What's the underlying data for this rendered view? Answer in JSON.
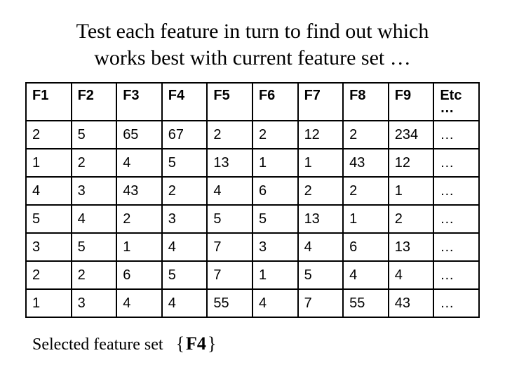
{
  "title_line1": "Test each feature in turn to find out which",
  "title_line2": "works best with current feature set …",
  "chart_data": {
    "type": "table",
    "headers": [
      "F1",
      "F2",
      "F3",
      "F4",
      "F5",
      "F6",
      "F7",
      "F8",
      "F9",
      "Etc"
    ],
    "rows": [
      [
        "2",
        "5",
        "65",
        "67",
        "2",
        "2",
        "12",
        "2",
        "234",
        "…"
      ],
      [
        "1",
        "2",
        "4",
        "5",
        "13",
        "1",
        "1",
        "43",
        "12",
        "…"
      ],
      [
        "4",
        "3",
        "43",
        "2",
        "4",
        "6",
        "2",
        "2",
        "1",
        "…"
      ],
      [
        "5",
        "4",
        "2",
        "3",
        "5",
        "5",
        "13",
        "1",
        "2",
        "…"
      ],
      [
        "3",
        "5",
        "1",
        "4",
        "7",
        "3",
        "4",
        "6",
        "13",
        "…"
      ],
      [
        "2",
        "2",
        "6",
        "5",
        "7",
        "1",
        "5",
        "4",
        "4",
        "…"
      ],
      [
        "1",
        "3",
        "4",
        "4",
        "55",
        "4",
        "7",
        "55",
        "43",
        "…"
      ]
    ]
  },
  "etc_dots": "…",
  "footer_label": "Selected feature set",
  "footer_set_open": "{",
  "footer_set_feature": "F4",
  "footer_set_close": "}"
}
